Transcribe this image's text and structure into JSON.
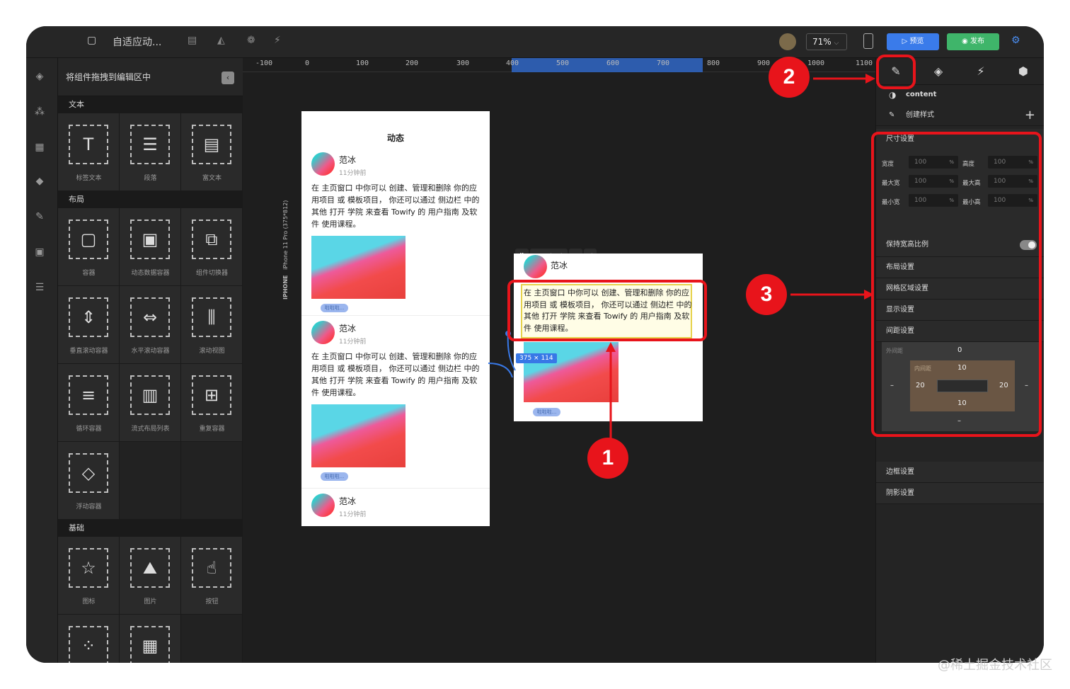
{
  "topbar": {
    "title": "自适应动...",
    "zoom": "71%",
    "preview": "预览",
    "publish": "发布"
  },
  "components": {
    "header": "将组件拖拽到编辑区中",
    "sections": [
      {
        "title": "文本",
        "items": [
          "标签文本",
          "段落",
          "富文本"
        ]
      },
      {
        "title": "布局",
        "items": [
          "容器",
          "动态数据容器",
          "组件切换器",
          "垂直滚动容器",
          "水平滚动容器",
          "滚动视图",
          "循环容器",
          "流式布局列表",
          "重复容器",
          "浮动容器"
        ]
      },
      {
        "title": "基础",
        "items": [
          "图标",
          "图片",
          "按钮"
        ]
      }
    ]
  },
  "ruler": [
    "-100",
    "0",
    "100",
    "200",
    "300",
    "400",
    "500",
    "600",
    "700",
    "800",
    "900",
    "1000",
    "1100"
  ],
  "phone": {
    "title": "动态",
    "device": "IPHONE",
    "device_model": "iPhone 11 Pro (375*812)",
    "posts": [
      {
        "name": "范冰",
        "time": "11分钟前",
        "text": "在 主页窗口 中你可以 创建、管理和删除 你的应用项目 或 模板项目， 你还可以通过 侧边栏 中的 其他 打开 学院 来查看 Towify 的 用户指南 及软件 使用课程。",
        "tag": "啦啦啦..."
      },
      {
        "name": "范冰",
        "time": "11分钟前",
        "text": "在 主页窗口 中你可以 创建、管理和删除 你的应用项目 或 模板项目， 你还可以通过 侧边栏 中的 其他 打开 学院 来查看 Towify 的 用户指南 及软件 使用课程。",
        "tag": "啦啦啦..."
      },
      {
        "name": "范冰",
        "time": "11分钟前"
      }
    ]
  },
  "detail": {
    "component": "content",
    "name_partial": "范冰",
    "text": "在 主页窗口 中你可以 创建、管理和删除 你的应用项目 或 模板项目， 你还可以通过 侧边栏 中的 其他 打开 学院 来查看 Towify 的 用户指南 及软件 使用课程。",
    "dimensions": "375 × 114",
    "tag": "啦啦啦..."
  },
  "badges": [
    "1",
    "2",
    "3"
  ],
  "right_panel": {
    "component": "content",
    "create_style": "创建样式",
    "size_title": "尺寸设置",
    "fields": [
      {
        "label": "宽度",
        "value": "100",
        "unit": "%"
      },
      {
        "label": "高度",
        "value": "100",
        "unit": "%"
      },
      {
        "label": "最大宽",
        "value": "100",
        "unit": "%"
      },
      {
        "label": "最大高",
        "value": "100",
        "unit": "%"
      },
      {
        "label": "最小宽",
        "value": "100",
        "unit": "%"
      },
      {
        "label": "最小高",
        "value": "100",
        "unit": "%"
      }
    ],
    "keep_ratio": "保持宽高比例",
    "sections": [
      "布局设置",
      "网格区域设置",
      "显示设置",
      "间距设置"
    ],
    "spacing": {
      "outer_label": "外间距",
      "inner_label": "内间距",
      "outer_top": "0",
      "outer_left": "–",
      "outer_right": "–",
      "outer_bottom": "–",
      "inner_top": "10",
      "inner_left": "20",
      "inner_right": "20",
      "inner_bottom": "10"
    },
    "sections_bottom": [
      "边框设置",
      "阴影设置"
    ]
  },
  "watermark": "@稀土掘金技术社区",
  "colors": {
    "accent_red": "#e8141b",
    "preview_blue": "#3a7bea",
    "publish_green": "#3fb56a"
  }
}
